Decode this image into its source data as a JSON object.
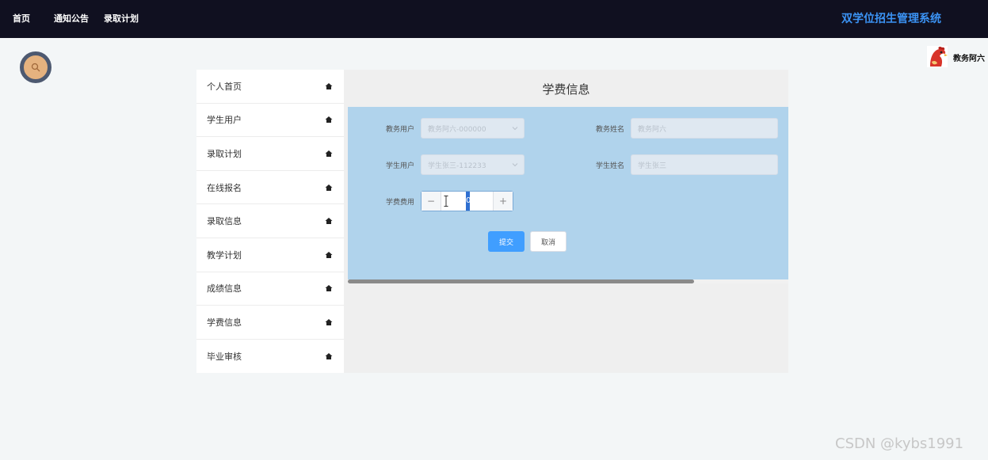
{
  "nav": {
    "home": "首页",
    "notices": "通知公告",
    "plans": "录取计划"
  },
  "brand": "双学位招生管理系统",
  "user": {
    "name": "教务阿六"
  },
  "sidebar": {
    "items": [
      {
        "label": "个人首页"
      },
      {
        "label": "学生用户"
      },
      {
        "label": "录取计划"
      },
      {
        "label": "在线报名"
      },
      {
        "label": "录取信息"
      },
      {
        "label": "教学计划"
      },
      {
        "label": "成绩信息"
      },
      {
        "label": "学费信息"
      },
      {
        "label": "毕业审核"
      }
    ]
  },
  "main": {
    "title": "学费信息"
  },
  "form": {
    "staff_user_label": "教务用户",
    "staff_user_value": "教务阿六-000000",
    "staff_name_label": "教务姓名",
    "staff_name_value": "教务阿六",
    "student_user_label": "学生用户",
    "student_user_value": "学生张三-112233",
    "student_name_label": "学生姓名",
    "student_name_value": "学生张三",
    "fee_label": "学费费用",
    "fee_value": "0",
    "fee_minus": "−",
    "fee_plus": "+",
    "submit_label": "提交",
    "cancel_label": "取消"
  },
  "watermark": "CSDN @kybs1991",
  "colors": {
    "topbar": "#101020",
    "brand": "#3b93f4",
    "form_bg": "#b0d3ec",
    "primary": "#409eff"
  }
}
